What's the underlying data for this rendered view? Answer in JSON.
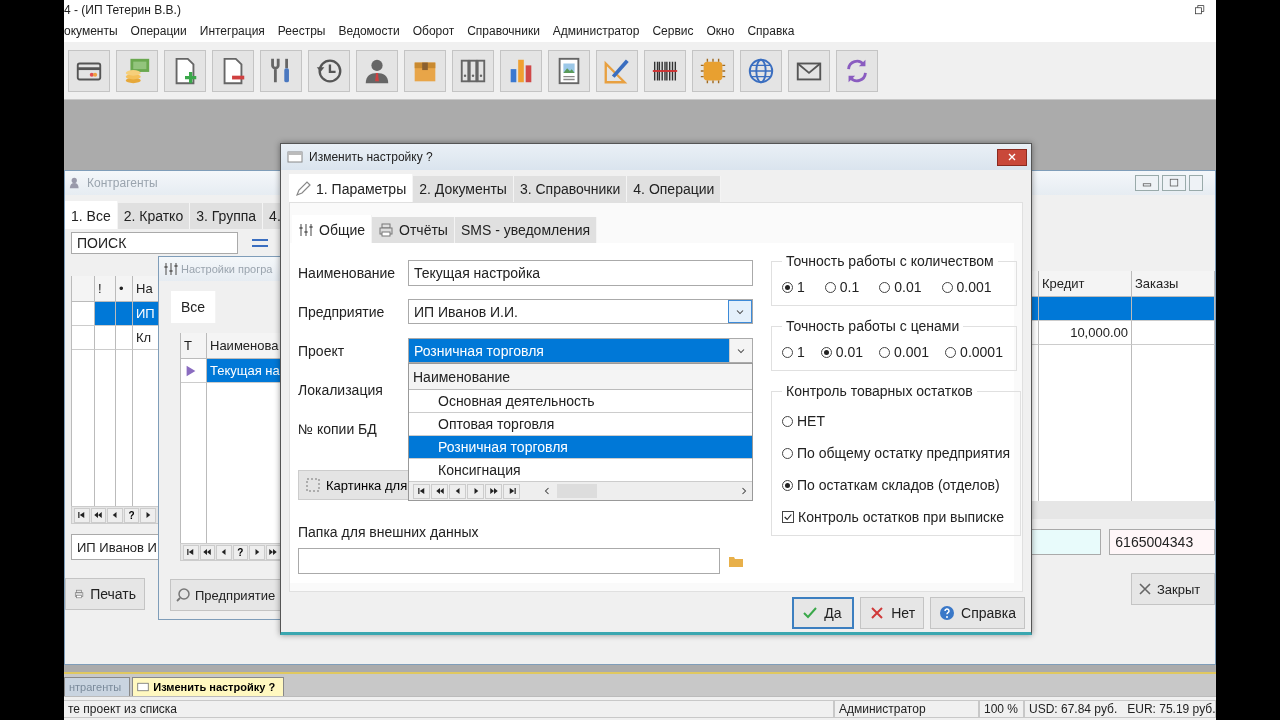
{
  "window": {
    "title": "4 - (ИП Тетерин В.В.)"
  },
  "menu": [
    "окументы",
    "Операции",
    "Интеграция",
    "Реестры",
    "Ведомости",
    "Оборот",
    "Справочники",
    "Администратор",
    "Сервис",
    "Окно",
    "Справка"
  ],
  "contractors": {
    "title": "Контрагенты",
    "tabs": [
      {
        "label": "1. Все",
        "selected": true
      },
      {
        "label": "2. Кратко",
        "selected": false
      },
      {
        "label": "3. Группа",
        "selected": false
      },
      {
        "label": "4.",
        "selected": false
      }
    ],
    "search": {
      "value": "ПОИСК"
    },
    "columns_left": [
      "!",
      "•",
      "На"
    ],
    "columns_right": [
      "Кредит",
      "Заказы"
    ],
    "rows": [
      {
        "name": "ИП",
        "selected": true
      },
      {
        "name": "Кл",
        "credit": "10,000.00",
        "selected": false
      }
    ],
    "navigator": [
      {
        "kind": "first"
      },
      {
        "kind": "prev-page"
      },
      {
        "kind": "prev"
      },
      {
        "kind": "help",
        "label": "?"
      },
      {
        "kind": "next"
      }
    ],
    "name_field": {
      "value": "ИП Иванов И"
    },
    "inn_field": {
      "value": "6165004343"
    },
    "print_button": "Печать",
    "close_button": "Закрыт"
  },
  "settings": {
    "title": "Настройки програ",
    "tabs": [
      {
        "label": "Все",
        "selected": true
      }
    ],
    "columns": [
      "Т",
      "Наименова"
    ],
    "rows": [
      {
        "name": "Текущая на",
        "selected": true
      }
    ],
    "navigator": [
      {
        "kind": "first"
      },
      {
        "kind": "prev-page"
      },
      {
        "kind": "prev"
      },
      {
        "kind": "help",
        "label": "?"
      },
      {
        "kind": "next"
      },
      {
        "kind": "next-page"
      }
    ],
    "button": "Предприятие"
  },
  "dialog": {
    "title": "Изменить настройку ?",
    "tabs": [
      {
        "label": "1. Параметры",
        "selected": true
      },
      {
        "label": "2. Документы",
        "selected": false
      },
      {
        "label": "3. Справочники",
        "selected": false
      },
      {
        "label": "4. Операции",
        "selected": false
      }
    ],
    "subtabs": [
      {
        "label": "Общие",
        "selected": true
      },
      {
        "label": "Отчёты",
        "selected": false
      },
      {
        "label": "SMS - уведомления",
        "selected": false
      }
    ],
    "form": {
      "name": {
        "label": "Наименование",
        "value": "Текущая настройка"
      },
      "company": {
        "label": "Предприятие",
        "value": "ИП Иванов И.И."
      },
      "project": {
        "label": "Проект",
        "value": "Розничная торговля",
        "expanded": true,
        "list_header": "Наименование",
        "options": [
          {
            "label": "Основная деятельность",
            "selected": false
          },
          {
            "label": "Оптовая торговля",
            "selected": false
          },
          {
            "label": "Розничная торговля",
            "selected": true
          },
          {
            "label": "Консигнация",
            "selected": false
          }
        ],
        "navigator": [
          {
            "kind": "first"
          },
          {
            "kind": "prev-page"
          },
          {
            "kind": "prev"
          },
          {
            "kind": "next"
          },
          {
            "kind": "next-page"
          },
          {
            "kind": "last"
          }
        ]
      },
      "localization": {
        "label": "Локализация"
      },
      "db_copy": {
        "label": "№ копии БД"
      },
      "picture_button": "Картинка для",
      "folder": {
        "label": "Папка для внешних данных"
      }
    },
    "qty_precision": {
      "title": "Точность работы с количеством",
      "options": [
        {
          "label": "1",
          "selected": true
        },
        {
          "label": "0.1",
          "selected": false
        },
        {
          "label": "0.01",
          "selected": false
        },
        {
          "label": "0.001",
          "selected": false
        }
      ]
    },
    "price_precision": {
      "title": "Точность работы с ценами",
      "options": [
        {
          "label": "1",
          "selected": false
        },
        {
          "label": "0.01",
          "selected": true
        },
        {
          "label": "0.001",
          "selected": false
        },
        {
          "label": "0.0001",
          "selected": false
        }
      ]
    },
    "stock_control": {
      "title": "Контроль товарных остатков",
      "options": [
        {
          "label": "НЕТ",
          "selected": false
        },
        {
          "label": "По общему остатку предприятия",
          "selected": false
        },
        {
          "label": "По остаткам складов (отделов)",
          "selected": true
        }
      ],
      "checkbox": {
        "label": "Контроль остатков при выписке",
        "checked": true
      }
    },
    "buttons": [
      {
        "kind": "ok",
        "label": "Да",
        "focused": true
      },
      {
        "kind": "cancel",
        "label": "Нет",
        "focused": false
      },
      {
        "kind": "help",
        "label": "Справка",
        "focused": false
      }
    ]
  },
  "mdi_tabs": [
    {
      "label": "нтрагенты",
      "selected": false
    },
    {
      "label": "Изменить настройку ?",
      "selected": true
    }
  ],
  "status_bar": {
    "message": "те проект из списка",
    "user": "Администратор",
    "zoom": "100 %",
    "usd": "USD: 67.84 руб.",
    "eur": "EUR: 75.19 руб."
  }
}
